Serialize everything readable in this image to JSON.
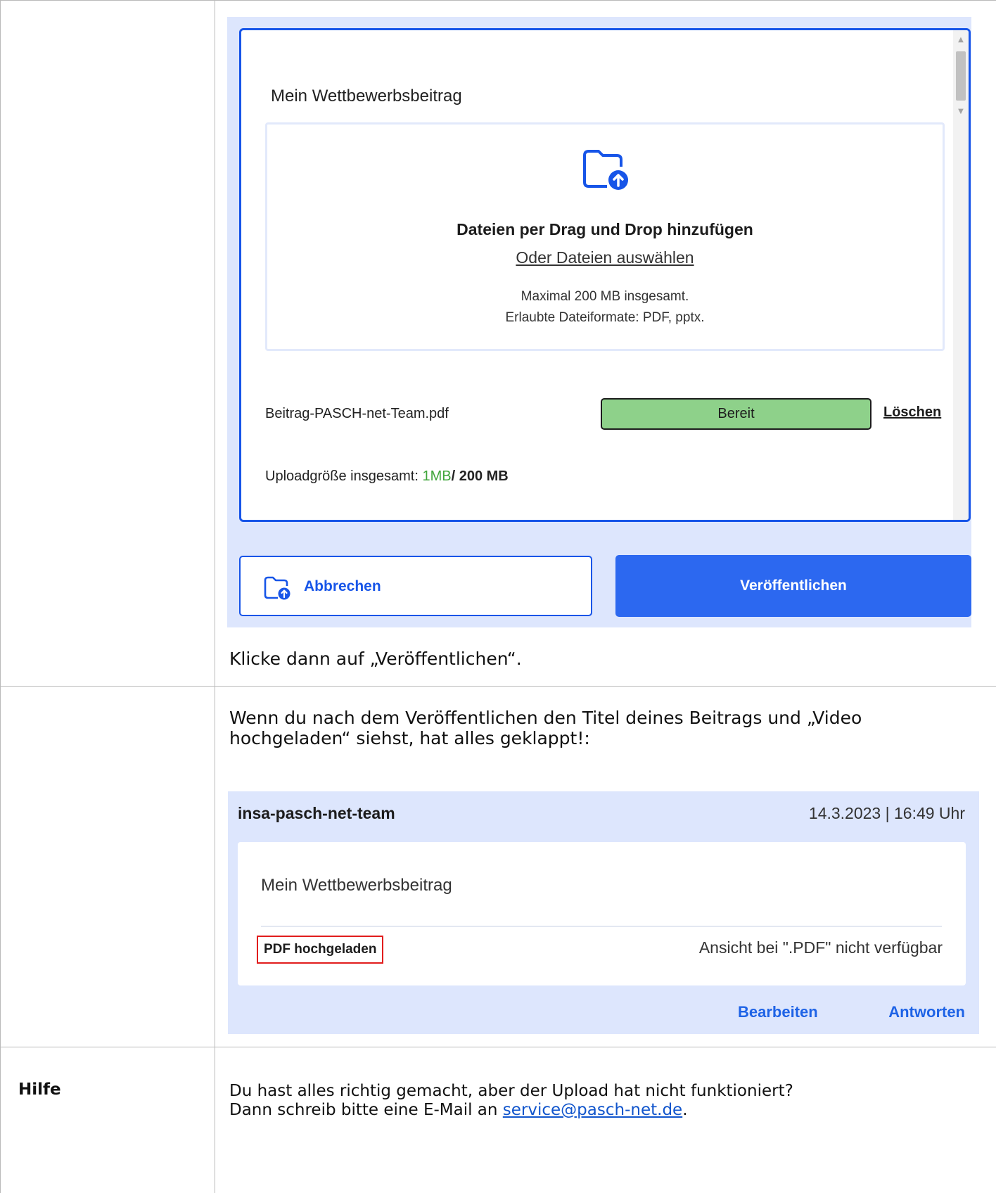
{
  "upload_dialog": {
    "title": "Mein Wettbewerbsbeitrag",
    "dropzone": {
      "icon": "folder-upload-icon",
      "heading": "Dateien per Drag und Drop hinzufügen",
      "select_link": "Oder Dateien auswählen",
      "note_line1": "Maximal 200 MB insgesamt.",
      "note_line2": "Erlaubte Dateiformate: PDF, pptx."
    },
    "file": {
      "name": "Beitrag-PASCH-net-Team.pdf",
      "status": "Bereit",
      "status_color": "#8ed18a",
      "delete_label": "Löschen"
    },
    "upload_size": {
      "label": "Uploadgröße insgesamt:",
      "used": "1MB",
      "max": "/ 200 MB"
    },
    "cancel_button": "Abbrechen",
    "publish_button": "Veröffentlichen",
    "accent_color": "#1755e8"
  },
  "row1": {
    "instruction": "Klicke dann auf „Veröffentlichen“."
  },
  "row2": {
    "instruction": "Wenn du nach dem Veröffentlichen den Titel deines Beitrags und „Video hochgeladen“ siehst, hat alles geklappt!:",
    "post": {
      "author": "insa-pasch-net-team",
      "date": "14.3.2023 | 16:49 Uhr",
      "title": "Mein Wettbewerbsbeitrag",
      "uploaded_badge": "PDF hochgeladen",
      "preview_note": "Ansicht bei \".PDF\" nicht verfügbar",
      "edit_label": "Bearbeiten",
      "reply_label": "Antworten"
    }
  },
  "row3": {
    "label": "Hilfe",
    "line1": "Du hast alles richtig gemacht, aber der Upload hat nicht funktioniert?",
    "line2_prefix": "Dann schreib bitte eine E-Mail an ",
    "email": "service@pasch-net.de",
    "line2_suffix": "."
  }
}
